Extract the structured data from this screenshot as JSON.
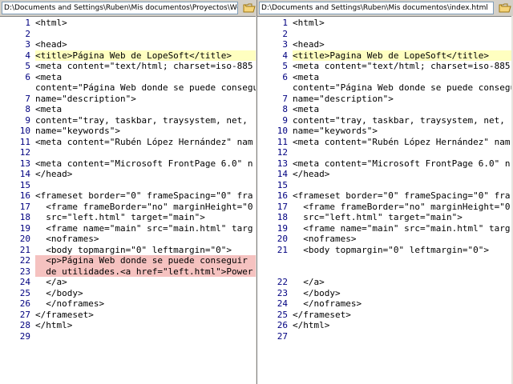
{
  "left_pane": {
    "path": "D:\\Documents and Settings\\Ruben\\Mis documentos\\Proyectos\\Web\\ind",
    "lines": [
      {
        "num": "1",
        "text": "<html>",
        "hl": ""
      },
      {
        "num": "2",
        "text": "",
        "hl": ""
      },
      {
        "num": "3",
        "text": "<head>",
        "hl": ""
      },
      {
        "num": "4",
        "text": "<title>Página Web de LopeSoft</title>",
        "hl": "yellow"
      },
      {
        "num": "5",
        "text": "<meta content=\"text/html; charset=iso-885",
        "hl": ""
      },
      {
        "num": "6",
        "text": "<meta",
        "hl": ""
      },
      {
        "num": "",
        "text": "content=\"Página Web donde se puede consegu",
        "hl": ""
      },
      {
        "num": "7",
        "text": "name=\"description\">",
        "hl": ""
      },
      {
        "num": "8",
        "text": "<meta",
        "hl": ""
      },
      {
        "num": "9",
        "text": "content=\"tray, taskbar, traysystem, net, ",
        "hl": ""
      },
      {
        "num": "10",
        "text": "name=\"keywords\">",
        "hl": ""
      },
      {
        "num": "11",
        "text": "<meta content=\"Rubén López Hernández\" nam",
        "hl": ""
      },
      {
        "num": "12",
        "text": "",
        "hl": ""
      },
      {
        "num": "13",
        "text": "<meta content=\"Microsoft FrontPage 6.0\" n",
        "hl": ""
      },
      {
        "num": "14",
        "text": "</head>",
        "hl": ""
      },
      {
        "num": "15",
        "text": "",
        "hl": ""
      },
      {
        "num": "16",
        "text": "<frameset border=\"0\" frameSpacing=\"0\" fra",
        "hl": ""
      },
      {
        "num": "17",
        "text": "  <frame frameBorder=\"no\" marginHeight=\"0",
        "hl": ""
      },
      {
        "num": "18",
        "text": "  src=\"left.html\" target=\"main\">",
        "hl": ""
      },
      {
        "num": "19",
        "text": "  <frame name=\"main\" src=\"main.html\" targ",
        "hl": ""
      },
      {
        "num": "20",
        "text": "  <noframes>",
        "hl": ""
      },
      {
        "num": "21",
        "text": "  <body topmargin=\"0\" leftmargin=\"0\">",
        "hl": ""
      },
      {
        "num": "22",
        "text": "  <p>Página Web donde se puede conseguir ",
        "hl": "red"
      },
      {
        "num": "23",
        "text": "  de utilidades.<a href=\"left.html\">Power",
        "hl": "red"
      },
      {
        "num": "24",
        "text": "  </a>",
        "hl": ""
      },
      {
        "num": "25",
        "text": "  </body>",
        "hl": ""
      },
      {
        "num": "26",
        "text": "  </noframes>",
        "hl": ""
      },
      {
        "num": "27",
        "text": "</frameset>",
        "hl": ""
      },
      {
        "num": "28",
        "text": "</html>",
        "hl": ""
      },
      {
        "num": "29",
        "text": "",
        "hl": ""
      }
    ]
  },
  "right_pane": {
    "path": "D:\\Documents and Settings\\Ruben\\Mis documentos\\index.html",
    "lines": [
      {
        "num": "1",
        "text": "<html>",
        "hl": ""
      },
      {
        "num": "2",
        "text": "",
        "hl": ""
      },
      {
        "num": "3",
        "text": "<head>",
        "hl": ""
      },
      {
        "num": "4",
        "text": "<title>Pagina Web de LopeSoft</title>",
        "hl": "yellow"
      },
      {
        "num": "5",
        "text": "<meta content=\"text/html; charset=iso-885",
        "hl": ""
      },
      {
        "num": "6",
        "text": "<meta",
        "hl": ""
      },
      {
        "num": "",
        "text": "content=\"Página Web donde se puede consegu",
        "hl": ""
      },
      {
        "num": "7",
        "text": "name=\"description\">",
        "hl": ""
      },
      {
        "num": "8",
        "text": "<meta",
        "hl": ""
      },
      {
        "num": "9",
        "text": "content=\"tray, taskbar, traysystem, net, ",
        "hl": ""
      },
      {
        "num": "10",
        "text": "name=\"keywords\">",
        "hl": ""
      },
      {
        "num": "11",
        "text": "<meta content=\"Rubén López Hernández\" nam",
        "hl": ""
      },
      {
        "num": "12",
        "text": "",
        "hl": "green"
      },
      {
        "num": "13",
        "text": "<meta content=\"Microsoft FrontPage 6.0\" n",
        "hl": ""
      },
      {
        "num": "14",
        "text": "</head>",
        "hl": ""
      },
      {
        "num": "15",
        "text": "",
        "hl": ""
      },
      {
        "num": "16",
        "text": "<frameset border=\"0\" frameSpacing=\"0\" fra",
        "hl": ""
      },
      {
        "num": "17",
        "text": "  <frame frameBorder=\"no\" marginHeight=\"0",
        "hl": ""
      },
      {
        "num": "18",
        "text": "  src=\"left.html\" target=\"main\">",
        "hl": ""
      },
      {
        "num": "19",
        "text": "  <frame name=\"main\" src=\"main.html\" targ",
        "hl": ""
      },
      {
        "num": "20",
        "text": "  <noframes>",
        "hl": ""
      },
      {
        "num": "21",
        "text": "  <body topmargin=\"0\" leftmargin=\"0\">",
        "hl": ""
      },
      {
        "num": "",
        "text": "",
        "hl": ""
      },
      {
        "num": "",
        "text": "",
        "hl": ""
      },
      {
        "num": "22",
        "text": "  </a>",
        "hl": ""
      },
      {
        "num": "23",
        "text": "  </body>",
        "hl": ""
      },
      {
        "num": "24",
        "text": "  </noframes>",
        "hl": ""
      },
      {
        "num": "25",
        "text": "</frameset>",
        "hl": ""
      },
      {
        "num": "26",
        "text": "</html>",
        "hl": ""
      },
      {
        "num": "27",
        "text": "",
        "hl": ""
      }
    ]
  }
}
